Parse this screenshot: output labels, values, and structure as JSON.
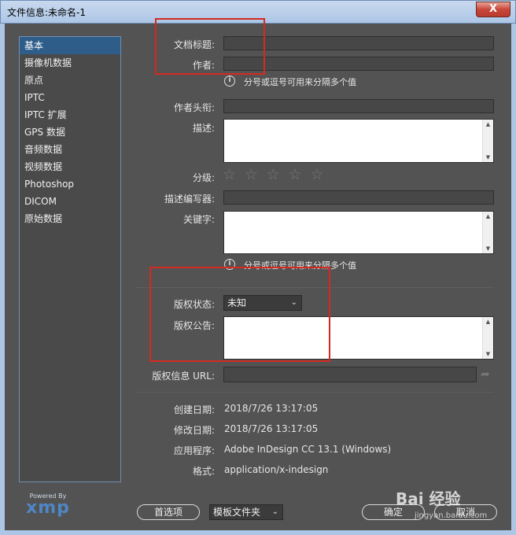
{
  "window": {
    "title": "文件信息:未命名-1",
    "close_label": "X"
  },
  "sidebar": {
    "items": [
      {
        "label": "基本"
      },
      {
        "label": "摄像机数据"
      },
      {
        "label": "原点"
      },
      {
        "label": "IPTC"
      },
      {
        "label": "IPTC 扩展"
      },
      {
        "label": "GPS 数据"
      },
      {
        "label": "音频数据"
      },
      {
        "label": "视频数据"
      },
      {
        "label": "Photoshop"
      },
      {
        "label": "DICOM"
      },
      {
        "label": "原始数据"
      }
    ],
    "selected_index": 0
  },
  "form": {
    "doc_title_label": "文档标题:",
    "author_label": "作者:",
    "hint_text": "分号或逗号可用来分隔多个值",
    "author_title_label": "作者头衔:",
    "description_label": "描述:",
    "rating_label": "分级:",
    "rating_value": 0,
    "rating_max": 5,
    "description_writer_label": "描述编写器:",
    "keywords_label": "关键字:",
    "keywords_hint": "分号或逗号可用来分隔多个值",
    "copyright_status_label": "版权状态:",
    "copyright_status_value": "未知",
    "copyright_notice_label": "版权公告:",
    "copyright_url_label": "版权信息 URL:",
    "created_label": "创建日期:",
    "created_value": "2018/7/26 13:17:05",
    "modified_label": "修改日期:",
    "modified_value": "2018/7/26 13:17:05",
    "app_label": "应用程序:",
    "app_value": "Adobe InDesign CC 13.1 (Windows)",
    "format_label": "格式:",
    "format_value": "application/x-indesign"
  },
  "footer": {
    "powered_by": "Powered By",
    "xmp_word": "xmp",
    "preferences_label": "首选项",
    "template_folder_label": "模板文件夹",
    "ok_label": "确定",
    "cancel_label": "取消"
  },
  "watermark": {
    "text": "Bai 经验",
    "url": "jingyan.baidu.com"
  },
  "colors": {
    "highlight_box": "#d42a20",
    "selected_bg": "#2f5d8a",
    "panel_bg": "#535353"
  },
  "icons": {
    "info": "info-icon",
    "star": "star-icon",
    "chevron": "chevron-down-icon",
    "go": "arrow-go-icon",
    "close": "close-icon"
  }
}
